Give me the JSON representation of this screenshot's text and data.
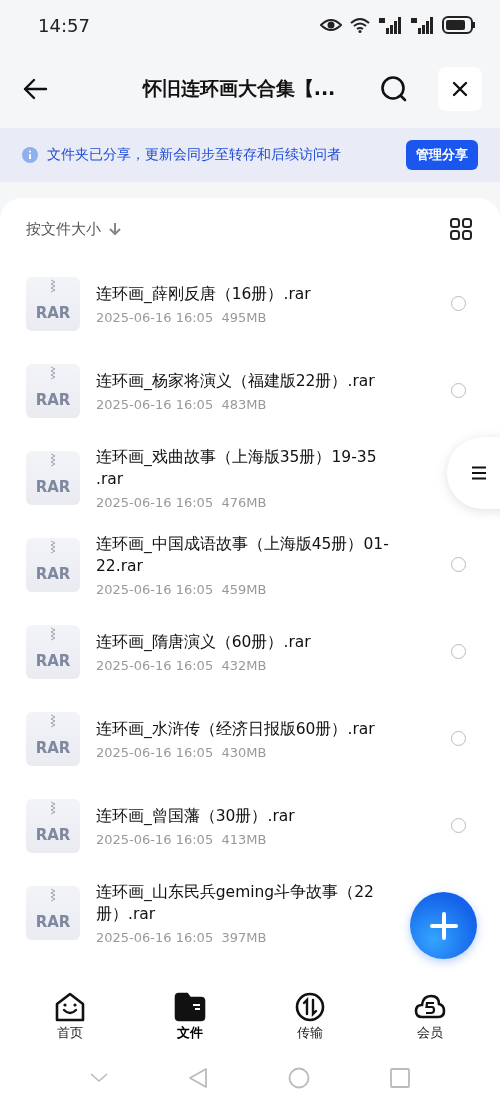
{
  "status_bar": {
    "time": "14:57"
  },
  "header": {
    "title": "怀旧连环画大合集【..."
  },
  "banner": {
    "text": "文件夹已分享，更新会同步至转存和后续访问者",
    "button": "管理分享"
  },
  "sort": {
    "label": "按文件大小"
  },
  "files": [
    {
      "type": "RAR",
      "name": "连环画_薛刚反唐（16册）.rar",
      "meta": "2025-06-16 16:05  495MB",
      "selected": false
    },
    {
      "type": "RAR",
      "name": "连环画_杨家将演义（福建版22册）.rar",
      "meta": "2025-06-16 16:05  483MB",
      "selected": false
    },
    {
      "type": "RAR",
      "name": "连环画_戏曲故事（上海版35册）19-35 .rar",
      "meta": "2025-06-16 16:05  476MB"
    },
    {
      "type": "RAR",
      "name": "连环画_中国成语故事（上海版45册）01-22.rar",
      "meta": "2025-06-16 16:05  459MB",
      "selected": false
    },
    {
      "type": "RAR",
      "name": "连环画_隋唐演义（60册）.rar",
      "meta": "2025-06-16 16:05  432MB",
      "selected": false
    },
    {
      "type": "RAR",
      "name": "连环画_水浒传（经济日报版60册）.rar",
      "meta": "2025-06-16 16:05  430MB",
      "selected": false
    },
    {
      "type": "RAR",
      "name": "连环画_曾国藩（30册）.rar",
      "meta": "2025-06-16 16:05  413MB",
      "selected": false
    },
    {
      "type": "RAR",
      "name": "连环画_山东民兵geming斗争故事（22册）.rar",
      "meta": "2025-06-16 16:05  397MB"
    }
  ],
  "nav": [
    {
      "kind": "home",
      "label": "首页",
      "selected": false
    },
    {
      "kind": "files",
      "label": "文件",
      "selected": true
    },
    {
      "kind": "transfer",
      "label": "传输",
      "selected": false
    },
    {
      "kind": "vip",
      "label": "会员",
      "selected": false
    }
  ]
}
